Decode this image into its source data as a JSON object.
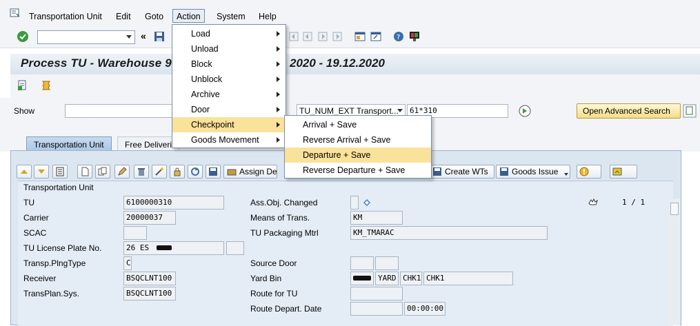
{
  "menubar": {
    "items": [
      "Transportation Unit",
      "Edit",
      "Goto",
      "Action",
      "System",
      "Help"
    ]
  },
  "page": {
    "title": "Process TU - Warehouse 9",
    "title_dates": "2020 - 19.12.2020"
  },
  "show": {
    "label": "Show",
    "value": "",
    "select_value": "TU_NUM_EXT Transport...",
    "search_value": "61*310",
    "advanced_button": "Open Advanced Search"
  },
  "tabs": [
    "Transportation Unit",
    "Free Deliveri"
  ],
  "content_toolbar": {
    "assign_label": "Assign De",
    "create_wts_label": "Create WTs",
    "goods_issue_label": "Goods Issue"
  },
  "form": {
    "group_title": "Transportation Unit",
    "left": [
      {
        "label": "TU",
        "value": "6100000310"
      },
      {
        "label": "Carrier",
        "value": "20000037"
      },
      {
        "label": "SCAC",
        "value": ""
      },
      {
        "label": "TU License Plate No.",
        "value": "26 ES"
      },
      {
        "label": "Transp.PlngType",
        "value": "C"
      },
      {
        "label": "Receiver",
        "value": "BSQCLNT100"
      },
      {
        "label": "TransPlan.Sys.",
        "value": "BSQCLNT100"
      }
    ],
    "right": [
      {
        "label": "Ass.Obj. Changed",
        "value": ""
      },
      {
        "label": "Means of Trans.",
        "value": "KM"
      },
      {
        "label": "TU Packaging Mtrl",
        "value": "KM_TMARAC"
      },
      {
        "label": "Source Door",
        "value": ""
      },
      {
        "label": "Yard Bin",
        "value": "YARD",
        "value2": "CHK1",
        "value3": "CHK1"
      },
      {
        "label": "Route for TU",
        "value": ""
      },
      {
        "label": "Route Depart. Date",
        "value": "",
        "time": "00:00:00"
      }
    ],
    "paging": "1 / 1"
  },
  "action_menu": {
    "items": [
      "Load",
      "Unload",
      "Block",
      "Unblock",
      "Archive",
      "Door",
      "Checkpoint",
      "Goods Movement"
    ],
    "highlighted": "Checkpoint"
  },
  "checkpoint_submenu": {
    "items": [
      "Arrival + Save",
      "Reverse Arrival + Save",
      "Departure + Save",
      "Reverse Departure + Save"
    ],
    "highlighted": "Departure + Save"
  },
  "colors": {
    "accent": "#fbe29a",
    "tab_active": "#a9c6e6",
    "background": "#f2f4f7"
  }
}
